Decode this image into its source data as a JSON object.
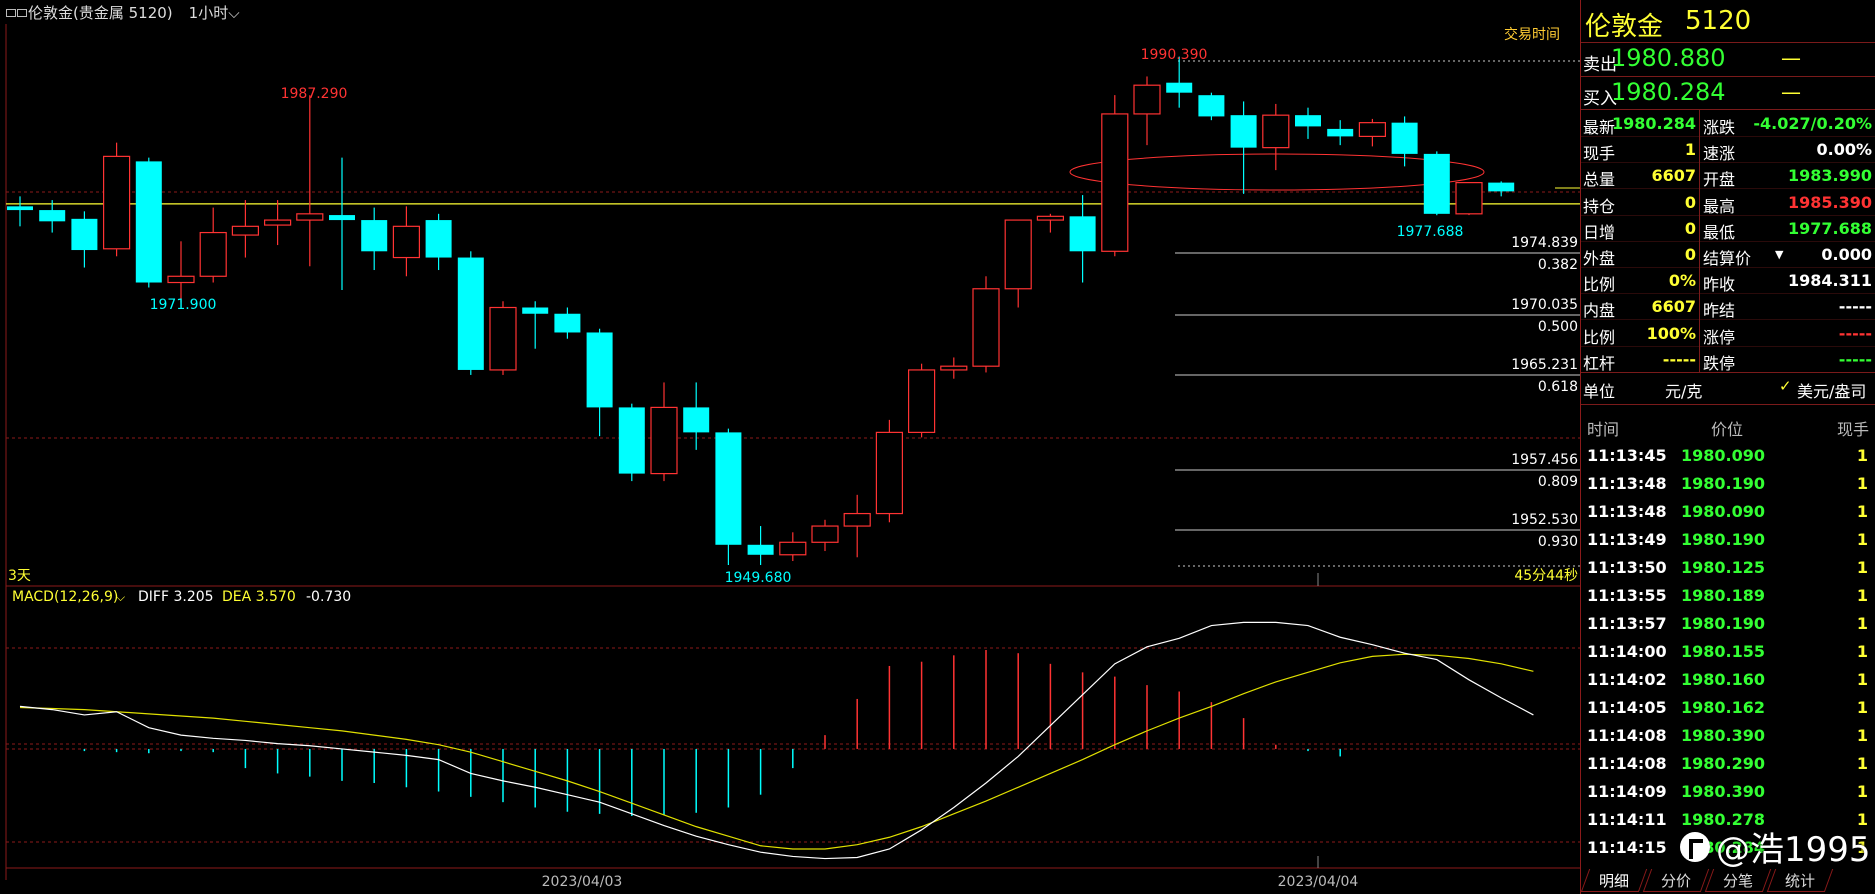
{
  "header": {
    "instrument": "伦敦金(贵金属 5120)",
    "period": "1小时"
  },
  "chart_labels": {
    "trade_time": "交易时间",
    "range_label": "3天",
    "countdown": "45分44秒",
    "macd_name": "MACD(12,26,9)",
    "diff": "DIFF 3.205",
    "dea": "DEA 3.570",
    "macd_value": "-0.730",
    "date_left": "2023/04/03",
    "date_right": "2023/04/04",
    "hi_left": "1987.290",
    "lo_left": "1971.900",
    "lo_mid": "1949.680",
    "hi_right": "1990.390",
    "lo_right": "1977.688"
  },
  "fib_levels": [
    {
      "price": "1974.839",
      "ratio": "0.382"
    },
    {
      "price": "1970.035",
      "ratio": "0.500"
    },
    {
      "price": "1965.231",
      "ratio": "0.618"
    },
    {
      "price": "1957.456",
      "ratio": "0.809"
    },
    {
      "price": "1952.530",
      "ratio": "0.930"
    }
  ],
  "colors": {
    "up": "#ff3333",
    "down": "#00ffff",
    "ma": "#ffff33",
    "macd_line": "#ffffff",
    "dea_line": "#e0e000",
    "panel_border": "#8b1a1a"
  },
  "chart_data": {
    "type": "candlestick",
    "candles": [
      {
        "o": 1978.4,
        "h": 1979.2,
        "l": 1976.8,
        "c": 1978.1
      },
      {
        "o": 1978.1,
        "h": 1978.9,
        "l": 1976.3,
        "c": 1977.2
      },
      {
        "o": 1977.4,
        "h": 1978.0,
        "l": 1973.5,
        "c": 1974.9
      },
      {
        "o": 1975.0,
        "h": 1983.5,
        "l": 1974.4,
        "c": 1982.4
      },
      {
        "o": 1982.0,
        "h": 1982.3,
        "l": 1971.9,
        "c": 1972.3
      },
      {
        "o": 1972.3,
        "h": 1975.6,
        "l": 1970.7,
        "c": 1972.8
      },
      {
        "o": 1972.8,
        "h": 1978.3,
        "l": 1972.3,
        "c": 1976.3
      },
      {
        "o": 1976.1,
        "h": 1978.9,
        "l": 1974.3,
        "c": 1976.8
      },
      {
        "o": 1976.9,
        "h": 1978.9,
        "l": 1975.3,
        "c": 1977.3
      },
      {
        "o": 1977.3,
        "h": 1987.29,
        "l": 1973.6,
        "c": 1977.8
      },
      {
        "o": 1977.7,
        "h": 1982.3,
        "l": 1971.7,
        "c": 1977.3
      },
      {
        "o": 1977.3,
        "h": 1978.3,
        "l": 1973.3,
        "c": 1974.8
      },
      {
        "o": 1974.3,
        "h": 1978.4,
        "l": 1972.8,
        "c": 1976.8
      },
      {
        "o": 1977.3,
        "h": 1977.8,
        "l": 1973.3,
        "c": 1974.3
      },
      {
        "o": 1974.3,
        "h": 1974.8,
        "l": 1964.9,
        "c": 1965.3
      },
      {
        "o": 1965.3,
        "h": 1970.8,
        "l": 1964.9,
        "c": 1970.3
      },
      {
        "o": 1970.3,
        "h": 1970.8,
        "l": 1967.0,
        "c": 1969.8
      },
      {
        "o": 1969.8,
        "h": 1970.3,
        "l": 1967.8,
        "c": 1968.3
      },
      {
        "o": 1968.3,
        "h": 1968.6,
        "l": 1960.0,
        "c": 1962.3
      },
      {
        "o": 1962.3,
        "h": 1962.6,
        "l": 1956.4,
        "c": 1957.0
      },
      {
        "o": 1957.0,
        "h": 1964.3,
        "l": 1956.4,
        "c": 1962.3
      },
      {
        "o": 1962.3,
        "h": 1964.3,
        "l": 1958.9,
        "c": 1960.3
      },
      {
        "o": 1960.3,
        "h": 1960.6,
        "l": 1949.68,
        "c": 1951.3
      },
      {
        "o": 1951.3,
        "h": 1952.8,
        "l": 1949.68,
        "c": 1950.5
      },
      {
        "o": 1950.5,
        "h": 1952.3,
        "l": 1950.0,
        "c": 1951.5
      },
      {
        "o": 1951.5,
        "h": 1953.3,
        "l": 1950.8,
        "c": 1952.8
      },
      {
        "o": 1952.8,
        "h": 1955.3,
        "l": 1950.3,
        "c": 1953.8
      },
      {
        "o": 1953.8,
        "h": 1961.3,
        "l": 1953.1,
        "c": 1960.3
      },
      {
        "o": 1960.3,
        "h": 1965.8,
        "l": 1959.9,
        "c": 1965.3
      },
      {
        "o": 1965.3,
        "h": 1966.3,
        "l": 1964.6,
        "c": 1965.6
      },
      {
        "o": 1965.6,
        "h": 1972.8,
        "l": 1965.1,
        "c": 1971.8
      },
      {
        "o": 1971.8,
        "h": 1977.3,
        "l": 1970.3,
        "c": 1977.3
      },
      {
        "o": 1977.3,
        "h": 1977.8,
        "l": 1976.3,
        "c": 1977.6
      },
      {
        "o": 1977.6,
        "h": 1979.3,
        "l": 1972.3,
        "c": 1974.8
      },
      {
        "o": 1974.8,
        "h": 1987.3,
        "l": 1974.4,
        "c": 1985.8
      },
      {
        "o": 1985.8,
        "h": 1988.8,
        "l": 1983.3,
        "c": 1988.1
      },
      {
        "o": 1988.3,
        "h": 1990.39,
        "l": 1986.3,
        "c": 1987.5
      },
      {
        "o": 1987.3,
        "h": 1987.5,
        "l": 1985.3,
        "c": 1985.6
      },
      {
        "o": 1985.7,
        "h": 1986.8,
        "l": 1979.4,
        "c": 1983.1
      },
      {
        "o": 1983.1,
        "h": 1986.6,
        "l": 1981.3,
        "c": 1985.7
      },
      {
        "o": 1985.7,
        "h": 1986.3,
        "l": 1983.8,
        "c": 1984.8
      },
      {
        "o": 1984.6,
        "h": 1985.3,
        "l": 1983.3,
        "c": 1984.0
      },
      {
        "o": 1984.0,
        "h": 1985.4,
        "l": 1983.2,
        "c": 1985.1
      },
      {
        "o": 1985.1,
        "h": 1985.6,
        "l": 1981.6,
        "c": 1982.6
      },
      {
        "o": 1982.6,
        "h": 1982.8,
        "l": 1977.688,
        "c": 1977.8
      },
      {
        "o": 1977.8,
        "h": 1980.1,
        "l": 1977.7,
        "c": 1980.3
      },
      {
        "o": 1980.3,
        "h": 1980.4,
        "l": 1979.2,
        "c": 1979.6
      }
    ],
    "price_range": [
      1948.0,
      1993.0
    ],
    "ma_level": 1978.6,
    "macd": {
      "hist": [
        -0.2,
        -0.3,
        -0.4,
        -0.2,
        -0.3,
        -1.8,
        -2.3,
        -2.6,
        -3.0,
        -3.2,
        -3.6,
        -4.0,
        -4.5,
        -5.0,
        -5.5,
        -5.9,
        -6.1,
        -6.3,
        -6.2,
        -6.0,
        -5.5,
        -4.3,
        -1.8,
        1.3,
        4.7,
        7.8,
        8.2,
        8.8,
        9.3,
        9.0,
        8.0,
        7.2,
        6.8,
        6.0,
        5.4,
        4.4,
        2.9,
        0.4,
        -0.2,
        -0.7
      ],
      "diff": [
        4.0,
        3.7,
        3.2,
        3.5,
        2.0,
        1.3,
        1.0,
        0.8,
        0.5,
        0.3,
        0.0,
        -0.3,
        -0.6,
        -1.0,
        -2.3,
        -3.0,
        -3.6,
        -4.3,
        -5.0,
        -6.1,
        -7.2,
        -8.2,
        -9.0,
        -9.7,
        -10.1,
        -10.3,
        -10.2,
        -9.4,
        -7.6,
        -5.5,
        -3.2,
        -0.7,
        2.2,
        5.1,
        8.0,
        9.6,
        10.4,
        11.6,
        11.9,
        11.9,
        11.6,
        10.5,
        9.8,
        9.0,
        8.4,
        6.5,
        4.8,
        3.2
      ],
      "dea": [
        3.9,
        3.8,
        3.7,
        3.5,
        3.3,
        3.1,
        2.9,
        2.6,
        2.3,
        2.0,
        1.7,
        1.3,
        0.9,
        0.4,
        -0.3,
        -1.2,
        -2.1,
        -3.0,
        -4.0,
        -5.1,
        -6.2,
        -7.3,
        -8.2,
        -9.1,
        -9.4,
        -9.4,
        -9.0,
        -8.3,
        -7.3,
        -6.1,
        -4.9,
        -3.6,
        -2.3,
        -1.0,
        0.4,
        1.7,
        2.9,
        4.0,
        5.2,
        6.3,
        7.2,
        8.1,
        8.7,
        8.9,
        8.8,
        8.5,
        8.0,
        7.3
      ],
      "range": [
        -11,
        14
      ]
    }
  },
  "quote": {
    "name": "伦敦金",
    "code": "5120",
    "sell_label": "卖出",
    "sell": "1980.880",
    "sell_vol": "—",
    "buy_label": "买入",
    "buy": "1980.284",
    "buy_vol": "—",
    "fields": [
      {
        "l1": "最新",
        "v1": "1980.284",
        "c1": "green",
        "l2": "涨跌",
        "v2": "-4.027/0.20%",
        "c2": "green"
      },
      {
        "l1": "现手",
        "v1": "1",
        "c1": "yellow",
        "l2": "速涨",
        "v2": "0.00%",
        "c2": "white"
      },
      {
        "l1": "总量",
        "v1": "6607",
        "c1": "yellow",
        "l2": "开盘",
        "v2": "1983.990",
        "c2": "green"
      },
      {
        "l1": "持仓",
        "v1": "0",
        "c1": "yellow",
        "l2": "最高",
        "v2": "1985.390",
        "c2": "red"
      },
      {
        "l1": "日增",
        "v1": "0",
        "c1": "yellow",
        "l2": "最低",
        "v2": "1977.688",
        "c2": "green"
      },
      {
        "l1": "外盘",
        "v1": "0",
        "c1": "yellow",
        "l2": "结算价",
        "v2": "0.000",
        "c2": "white"
      },
      {
        "l1": "比例",
        "v1": "0%",
        "c1": "yellow",
        "l2": "昨收",
        "v2": "1984.311",
        "c2": "white"
      },
      {
        "l1": "内盘",
        "v1": "6607",
        "c1": "yellow",
        "l2": "昨结",
        "v2": "-----",
        "c2": "white"
      },
      {
        "l1": "比例",
        "v1": "100%",
        "c1": "yellow",
        "l2": "涨停",
        "v2": "-----",
        "c2": "red"
      },
      {
        "l1": "杠杆",
        "v1": "-----",
        "c1": "yellow",
        "l2": "跌停",
        "v2": "-----",
        "c2": "green"
      }
    ],
    "unit_label": "单位",
    "unit_a": "元/克",
    "unit_b": "美元/盎司",
    "unit_b_check": "✓"
  },
  "ticks": {
    "headers": [
      "时间",
      "价位",
      "现手"
    ],
    "rows": [
      {
        "t": "11:13:45",
        "p": "1980.090",
        "v": "1"
      },
      {
        "t": "11:13:48",
        "p": "1980.190",
        "v": "1"
      },
      {
        "t": "11:13:48",
        "p": "1980.090",
        "v": "1"
      },
      {
        "t": "11:13:49",
        "p": "1980.190",
        "v": "1"
      },
      {
        "t": "11:13:50",
        "p": "1980.125",
        "v": "1"
      },
      {
        "t": "11:13:55",
        "p": "1980.189",
        "v": "1"
      },
      {
        "t": "11:13:57",
        "p": "1980.190",
        "v": "1"
      },
      {
        "t": "11:14:00",
        "p": "1980.155",
        "v": "1"
      },
      {
        "t": "11:14:02",
        "p": "1980.160",
        "v": "1"
      },
      {
        "t": "11:14:05",
        "p": "1980.162",
        "v": "1"
      },
      {
        "t": "11:14:08",
        "p": "1980.390",
        "v": "1"
      },
      {
        "t": "11:14:08",
        "p": "1980.290",
        "v": "1"
      },
      {
        "t": "11:14:09",
        "p": "1980.390",
        "v": "1"
      },
      {
        "t": "11:14:11",
        "p": "1980.278",
        "v": "1"
      },
      {
        "t": "11:14:15",
        "p": "1980.284",
        "v": "1"
      }
    ]
  },
  "tabs": [
    "明细",
    "分价",
    "分笔",
    "统计"
  ],
  "watermark": "@浩1995"
}
